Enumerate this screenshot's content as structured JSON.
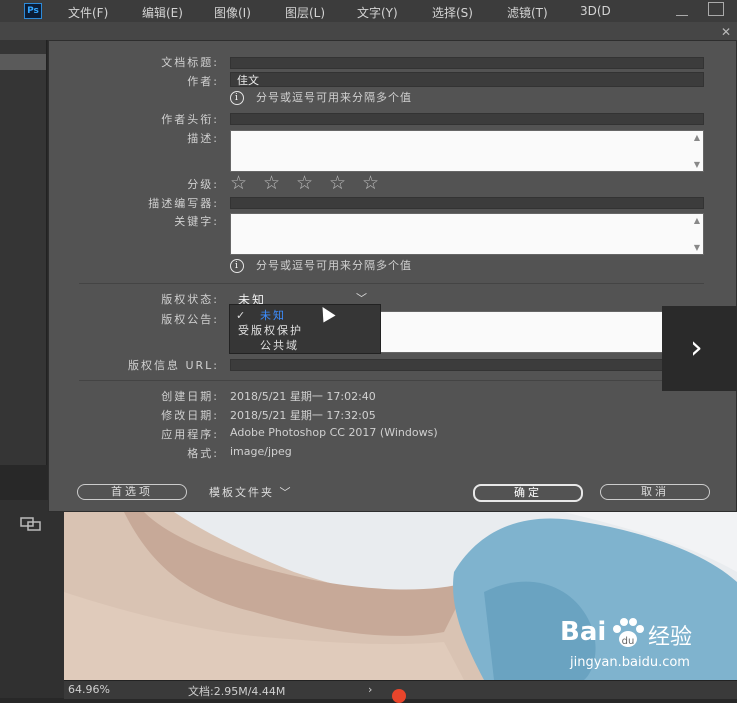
{
  "app": {
    "logo": "Ps",
    "menu": [
      "文件(F)",
      "编辑(E)",
      "图像(I)",
      "图层(L)",
      "文字(Y)",
      "选择(S)",
      "滤镜(T)",
      "3D(D"
    ]
  },
  "dialog": {
    "labels": {
      "doc_title": "文档标题:",
      "author": "作者:",
      "author_title": "作者头衔:",
      "description": "描述:",
      "rating": "分级:",
      "desc_writer": "描述编写器:",
      "keywords": "关键字:",
      "copyright_status": "版权状态:",
      "copyright_notice": "版权公告:",
      "copyright_url": "版权信息 URL:",
      "created": "创建日期:",
      "modified": "修改日期:",
      "application": "应用程序:",
      "format": "格式:"
    },
    "values": {
      "doc_title": "",
      "author": "佳文",
      "author_title": "",
      "description": "",
      "desc_writer": "",
      "keywords": "",
      "copyright_url": "",
      "created": "2018/5/21 星期一 17:02:40",
      "modified": "2018/5/21 星期一 17:32:05",
      "application": "Adobe Photoshop CC 2017 (Windows)",
      "format": "image/jpeg"
    },
    "hint_author": "分号或逗号可用来分隔多个值",
    "hint_keywords": "分号或逗号可用来分隔多个值",
    "rating_stars": 5,
    "rating_value": 0,
    "copyright_status_value": "未知",
    "copyright_options": [
      "未知",
      "受版权保护",
      "公共域"
    ],
    "buttons": {
      "preferences": "首选项",
      "template_folder": "模板文件夹",
      "ok": "确定",
      "cancel": "取消"
    }
  },
  "statusbar": {
    "zoom": "64.96%",
    "doc_size": "文档:2.95M/4.44M"
  },
  "watermark": {
    "brand": "Bai",
    "brand2": "经验",
    "url": "jingyan.baidu.com"
  }
}
